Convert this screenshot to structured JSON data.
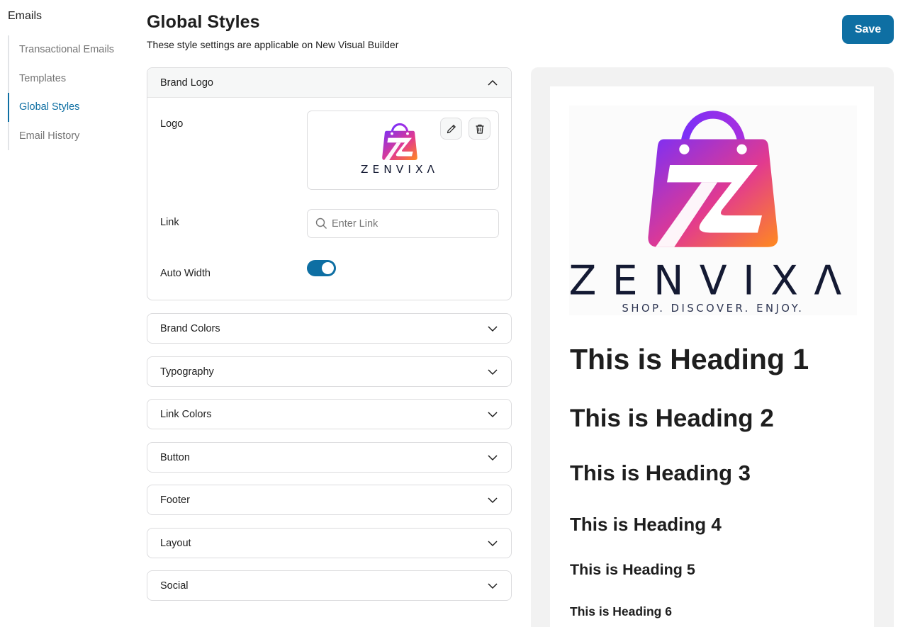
{
  "sidebar": {
    "title": "Emails",
    "items": [
      {
        "label": "Transactional Emails",
        "active": false
      },
      {
        "label": "Templates",
        "active": false
      },
      {
        "label": "Global Styles",
        "active": true
      },
      {
        "label": "Email History",
        "active": false
      }
    ]
  },
  "header": {
    "title": "Global Styles",
    "subtitle": "These style settings are applicable on New Visual Builder",
    "save_label": "Save"
  },
  "brand_logo": {
    "label": "Brand Logo",
    "logo_label": "Logo",
    "link_label": "Link",
    "link_placeholder": "Enter Link",
    "link_value": "",
    "auto_width_label": "Auto Width",
    "auto_width_on": true
  },
  "sections": [
    {
      "label": "Brand Colors"
    },
    {
      "label": "Typography"
    },
    {
      "label": "Link Colors"
    },
    {
      "label": "Button"
    },
    {
      "label": "Footer"
    },
    {
      "label": "Layout"
    },
    {
      "label": "Social"
    }
  ],
  "logo": {
    "wordmark": "ZENVIXA",
    "tagline": "SHOP. DISCOVER. ENJOY."
  },
  "preview": {
    "h1": "This is Heading 1",
    "h2": "This is Heading 2",
    "h3": "This is Heading 3",
    "h4": "This is Heading 4",
    "h5": "This is Heading 5",
    "h6": "This is Heading 6"
  },
  "colors": {
    "accent": "#0e6fa3",
    "logo_gradient_start": "#7b2ff7",
    "logo_gradient_mid": "#e23a8f",
    "logo_gradient_end": "#ff8a1e",
    "logo_text": "#141a33"
  }
}
